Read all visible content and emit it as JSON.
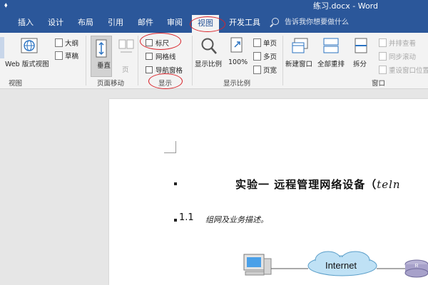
{
  "window": {
    "title": "练习.docx - Word",
    "qat_glyph": "⬧"
  },
  "tabs": [
    {
      "label": "插入"
    },
    {
      "label": "设计"
    },
    {
      "label": "布局"
    },
    {
      "label": "引用"
    },
    {
      "label": "邮件"
    },
    {
      "label": "审阅"
    },
    {
      "label": "视图"
    },
    {
      "label": "开发工具"
    }
  ],
  "search": {
    "placeholder": "告诉我你想要做什么"
  },
  "ribbon": {
    "views": {
      "web_layout": "Web 版式视图",
      "outline": "大纲",
      "draft": "草稿",
      "group_label": "视图"
    },
    "page_movement": {
      "vertical": "垂直",
      "side_by_side": "页",
      "group_label": "页面移动"
    },
    "show": {
      "ruler": "标尺",
      "gridlines": "网格线",
      "nav_pane": "导航窗格",
      "group_label": "显示",
      "ruler_checked": false,
      "gridlines_checked": false,
      "nav_pane_checked": false
    },
    "zoom": {
      "zoom": "显示比例",
      "hundred": "100%",
      "one_page": "单页",
      "multi_page": "多页",
      "page_width": "页宽",
      "group_label": "显示比例"
    },
    "window": {
      "new_window": "新建窗口",
      "arrange_all": "全部重排",
      "split": "拆分",
      "side_by_side": "并排查看",
      "sync_scroll": "同步滚动",
      "reset_position": "重设窗口位置",
      "group_label": "窗口"
    }
  },
  "document": {
    "heading": "实验一  远程管理网络设备（",
    "heading_tail": "teln",
    "sub_number": "1.1",
    "sub_text": "组网及业务描述。",
    "diagram": {
      "internet_label": "Internet"
    }
  },
  "colors": {
    "accent": "#2b579a",
    "annotation": "#d9232a"
  }
}
